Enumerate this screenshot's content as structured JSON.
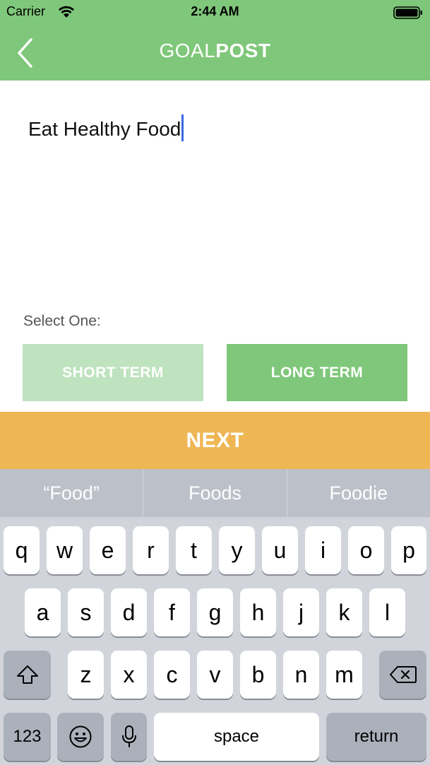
{
  "status_bar": {
    "carrier": "Carrier",
    "time": "2:44 AM"
  },
  "nav": {
    "title_light": "GOAL",
    "title_bold": "POST",
    "back_icon": "chevron-left-icon"
  },
  "goal_input": {
    "value": "Eat Healthy Food"
  },
  "select_label": "Select One:",
  "term_options": {
    "short": "SHORT TERM",
    "long": "LONG TERM"
  },
  "next_label": "NEXT",
  "suggestions": [
    "“Food”",
    "Foods",
    "Foodie"
  ],
  "keyboard": {
    "row1": [
      "q",
      "w",
      "e",
      "r",
      "t",
      "y",
      "u",
      "i",
      "o",
      "p"
    ],
    "row2": [
      "a",
      "s",
      "d",
      "f",
      "g",
      "h",
      "j",
      "k",
      "l"
    ],
    "row3": [
      "z",
      "x",
      "c",
      "v",
      "b",
      "n",
      "m"
    ],
    "numbers_label": "123",
    "space_label": "space",
    "return_label": "return"
  },
  "colors": {
    "brand_green": "#7fc77a",
    "light_green": "#bfe3bf",
    "next_orange": "#efb654",
    "caret_blue": "#3c69e0"
  }
}
